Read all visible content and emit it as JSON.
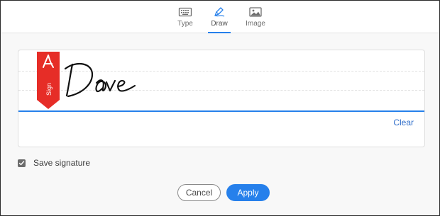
{
  "tabs": [
    {
      "label": "Type",
      "icon": "keyboard-icon",
      "active": false
    },
    {
      "label": "Draw",
      "icon": "pen-icon",
      "active": true
    },
    {
      "label": "Image",
      "icon": "image-icon",
      "active": false
    }
  ],
  "signature_pad": {
    "flag_text": "Sign",
    "flag_icon": "acrobat-logo-icon",
    "drawn_signature": "Dave",
    "clear_label": "Clear"
  },
  "save_signature": {
    "label": "Save signature",
    "checked": true
  },
  "actions": {
    "cancel_label": "Cancel",
    "apply_label": "Apply"
  },
  "colors": {
    "accent": "#2680eb",
    "flag_red": "#e62d27",
    "link": "#2d6cc9",
    "ink": "#111111"
  }
}
